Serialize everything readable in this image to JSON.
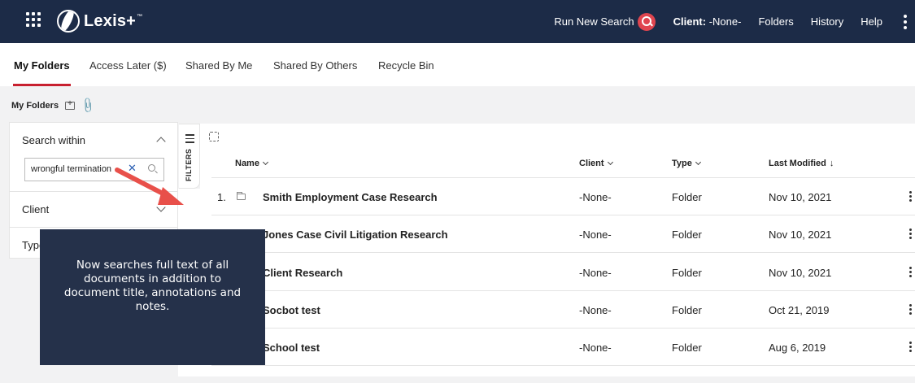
{
  "header": {
    "logo_text": "Lexis+",
    "logo_tm": "™",
    "run_new_search": "Run New Search",
    "client_label": "Client:",
    "client_value": "-None-",
    "nav": [
      "Folders",
      "History",
      "Help"
    ]
  },
  "tabs": [
    "My Folders",
    "Access Later ($)",
    "Shared By Me",
    "Shared By Others",
    "Recycle Bin"
  ],
  "active_tab": "My Folders",
  "breadcrumb": {
    "title": "My Folders"
  },
  "filters": {
    "search_within_label": "Search within",
    "search_value": "wrongful termination",
    "client_label": "Client",
    "type_label": "Type",
    "filters_tab_label": "FILTERS"
  },
  "table": {
    "columns": {
      "name": "Name",
      "client": "Client",
      "type": "Type",
      "last_modified": "Last Modified"
    },
    "rows": [
      {
        "num": "1.",
        "name": "Smith Employment Case Research",
        "client": "-None-",
        "type": "Folder",
        "date": "Nov 10, 2021"
      },
      {
        "num": "",
        "name": "Jones Case Civil Litigation Research",
        "client": "-None-",
        "type": "Folder",
        "date": "Nov 10, 2021"
      },
      {
        "num": "",
        "name": "Client Research",
        "client": "-None-",
        "type": "Folder",
        "date": "Nov 10, 2021"
      },
      {
        "num": "",
        "name": "Socbot test",
        "client": "-None-",
        "type": "Folder",
        "date": "Oct 21, 2019"
      },
      {
        "num": "",
        "name": "School test",
        "client": "-None-",
        "type": "Folder",
        "date": "Aug 6, 2019"
      }
    ]
  },
  "tooltip": {
    "text": "Now searches full text of all documents in addition to document title, annotations and notes."
  },
  "colors": {
    "header_bg": "#1c2b47",
    "accent_red": "#c8202f",
    "tooltip_bg": "#25314a",
    "arrow": "#e8504a"
  }
}
